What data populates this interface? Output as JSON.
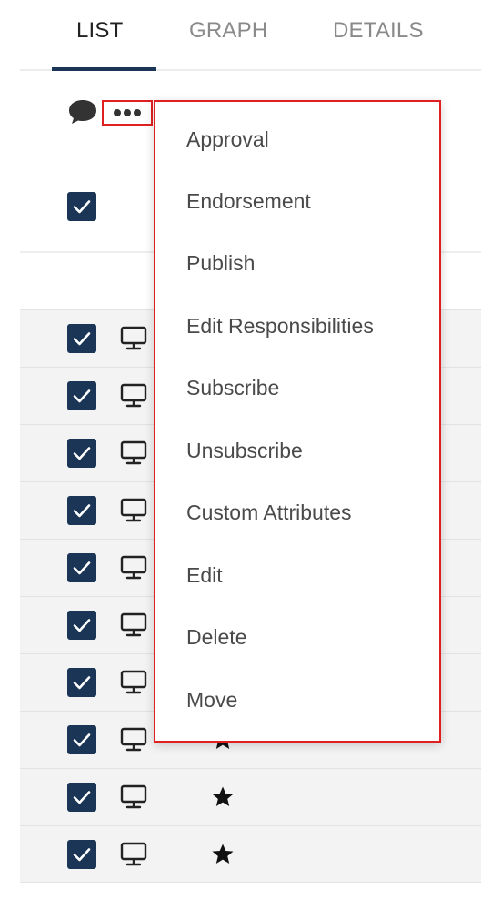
{
  "tabs": [
    {
      "label": "LIST",
      "active": true
    },
    {
      "label": "GRAPH",
      "active": false
    },
    {
      "label": "DETAILS",
      "active": false
    }
  ],
  "colors": {
    "accent": "#1a3556",
    "highlight_border": "#e02020",
    "row_background": "#f3f3f3"
  },
  "toolbar": {
    "comment_icon": "comment-icon",
    "more_icon": "more-horizontal-icon"
  },
  "menu": {
    "items": [
      {
        "label": "Approval"
      },
      {
        "label": "Endorsement"
      },
      {
        "label": "Publish"
      },
      {
        "label": "Edit Responsibilities"
      },
      {
        "label": "Subscribe"
      },
      {
        "label": "Unsubscribe"
      },
      {
        "label": "Custom Attributes"
      },
      {
        "label": "Edit"
      },
      {
        "label": "Delete"
      },
      {
        "label": "Move"
      }
    ]
  },
  "rows": [
    {
      "checked": true,
      "icon": "monitor-icon",
      "starred": false
    },
    {
      "checked": true,
      "icon": "monitor-icon",
      "starred": false
    },
    {
      "checked": true,
      "icon": "monitor-icon",
      "starred": false
    },
    {
      "checked": true,
      "icon": "monitor-icon",
      "starred": false
    },
    {
      "checked": true,
      "icon": "monitor-icon",
      "starred": false
    },
    {
      "checked": true,
      "icon": "monitor-icon",
      "starred": false
    },
    {
      "checked": true,
      "icon": "monitor-icon",
      "starred": false
    },
    {
      "checked": true,
      "icon": "monitor-icon",
      "starred": true
    },
    {
      "checked": true,
      "icon": "monitor-icon",
      "starred": true
    },
    {
      "checked": true,
      "icon": "monitor-icon",
      "starred": true
    }
  ]
}
